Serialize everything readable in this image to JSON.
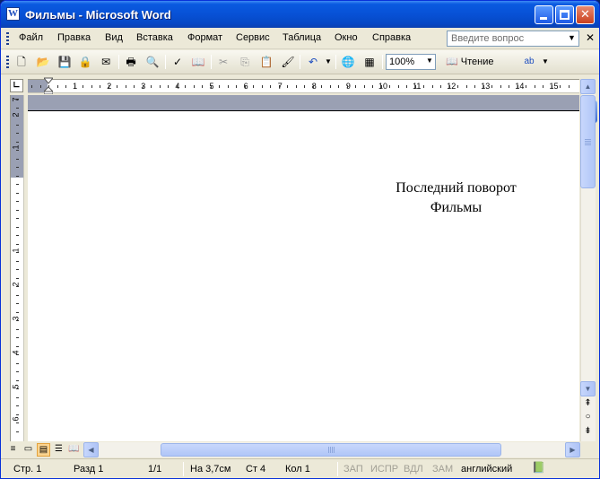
{
  "window": {
    "title": "Фильмы - Microsoft Word",
    "app_icon_letter": "W"
  },
  "menu": {
    "items": [
      "Файл",
      "Правка",
      "Вид",
      "Вставка",
      "Формат",
      "Сервис",
      "Таблица",
      "Окно",
      "Справка"
    ],
    "help_placeholder": "Введите вопрос"
  },
  "toolbar": {
    "zoom": "100%",
    "read_label": "Чтение"
  },
  "ruler": {
    "h_numbers": [
      "1",
      "2",
      "3",
      "4",
      "5",
      "6",
      "7",
      "8",
      "9",
      "10",
      "11",
      "12",
      "13",
      "14",
      "15"
    ],
    "v_numbers": [
      "2",
      "1",
      "1",
      "2",
      "3",
      "4",
      "5",
      "6",
      "7"
    ]
  },
  "document": {
    "lines": [
      "Последний поворот",
      "Фильмы"
    ]
  },
  "status": {
    "page": "Стр. 1",
    "section": "Разд 1",
    "pages": "1/1",
    "position": "На 3,7см",
    "line": "Ст 4",
    "column": "Кол 1",
    "rec": "ЗАП",
    "trk": "ИСПР",
    "ext": "ВДЛ",
    "ovr": "ЗАМ",
    "language": "английский"
  },
  "colors": {
    "titlebar": "#0751d6",
    "page": "#ffffff",
    "workspace": "#9aa0b3"
  }
}
